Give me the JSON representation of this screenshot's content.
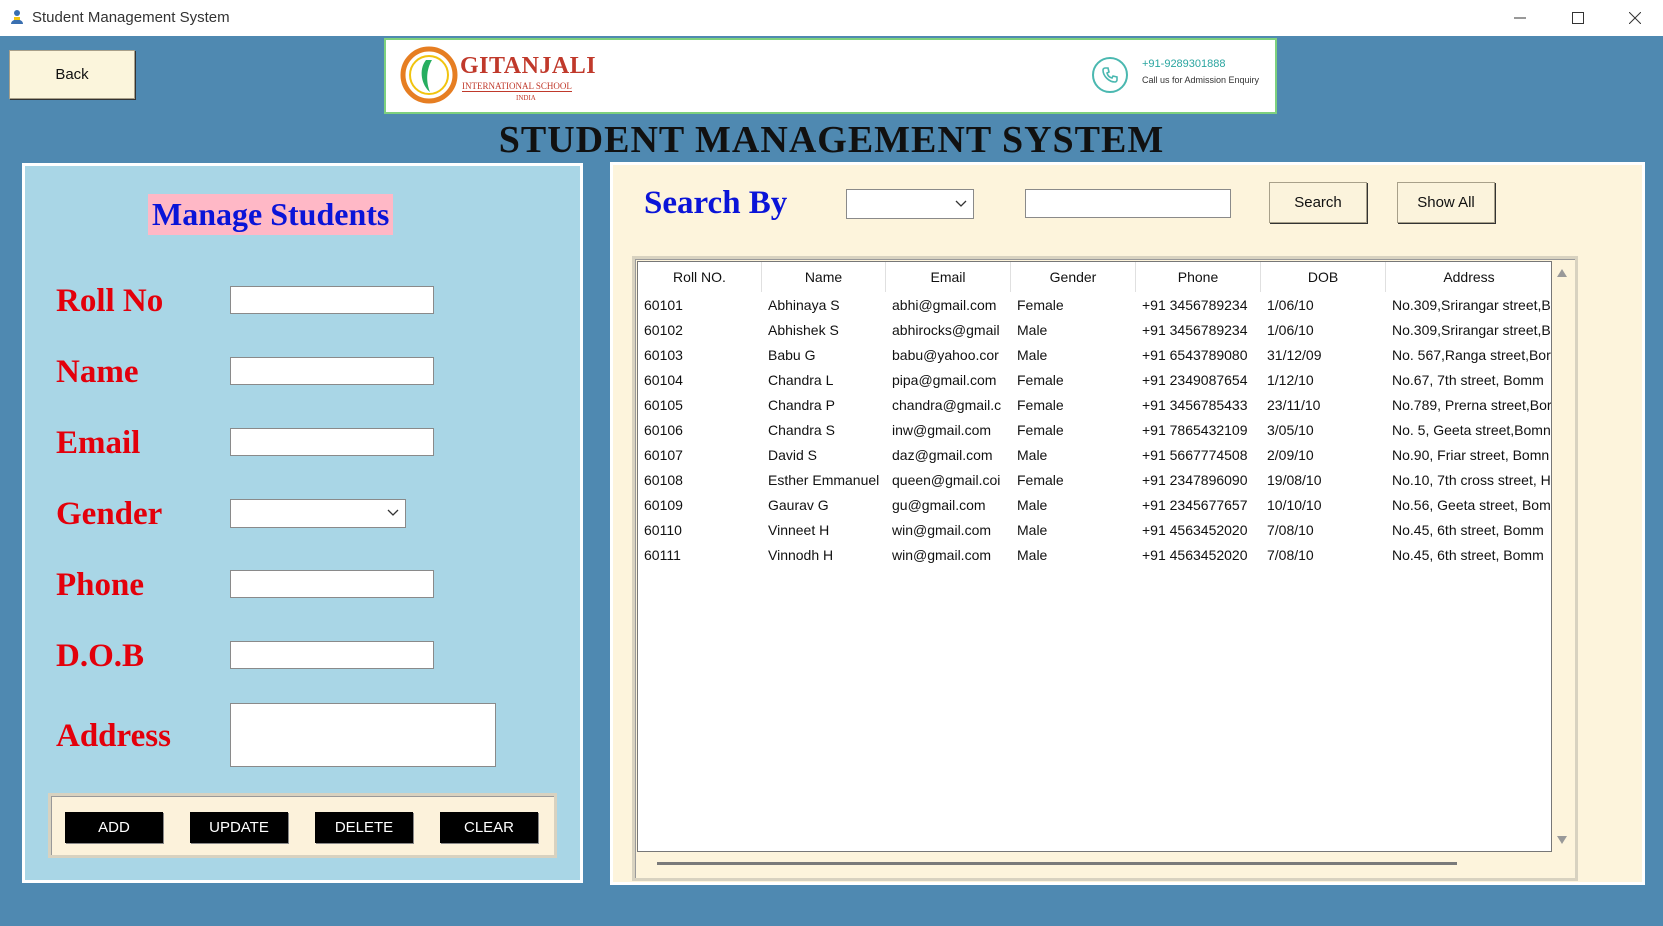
{
  "window": {
    "title": "Student Management System",
    "icons": {
      "app": "student-app-icon",
      "minimize": "minimize-icon",
      "maximize": "maximize-icon",
      "close": "close-icon"
    }
  },
  "header": {
    "back_label": "Back",
    "school_name": "GITANJALI",
    "school_subtitle": "INTERNATIONAL SCHOOL",
    "school_country": "INDIA",
    "phone": "+91-9289301888",
    "phone_note": "Call us for Admission Enquiry",
    "main_title": "STUDENT MANAGEMENT SYSTEM"
  },
  "manage": {
    "title": "Manage Students",
    "fields": {
      "roll_no": {
        "label": "Roll No",
        "value": ""
      },
      "name": {
        "label": "Name",
        "value": ""
      },
      "email": {
        "label": "Email",
        "value": ""
      },
      "gender": {
        "label": "Gender",
        "value": ""
      },
      "phone": {
        "label": "Phone",
        "value": ""
      },
      "dob": {
        "label": "D.O.B",
        "value": ""
      },
      "address": {
        "label": "Address",
        "value": ""
      }
    },
    "buttons": {
      "add": "ADD",
      "update": "UPDATE",
      "delete": "DELETE",
      "clear": "CLEAR"
    }
  },
  "search": {
    "label": "Search By",
    "by_value": "",
    "text_value": "",
    "search_label": "Search",
    "show_all_label": "Show All"
  },
  "table": {
    "columns": [
      "Roll NO.",
      "Name",
      "Email",
      "Gender",
      "Phone",
      "DOB",
      "Address"
    ],
    "rows": [
      [
        "60101",
        "Abhinaya S",
        "abhi@gmail.com",
        "Female",
        "+91 3456789234",
        "1/06/10",
        "No.309,Srirangar street,B"
      ],
      [
        "60102",
        "Abhishek S",
        "abhirocks@gmail",
        "Male",
        "+91 3456789234",
        "1/06/10",
        "No.309,Srirangar street,B"
      ],
      [
        "60103",
        "Babu G",
        "babu@yahoo.cor",
        "Male",
        "+91 6543789080",
        "31/12/09",
        "No. 567,Ranga street,Bor"
      ],
      [
        "60104",
        "Chandra L",
        "pipa@gmail.com",
        "Female",
        "+91 2349087654",
        "1/12/10",
        "No.67, 7th street, Bomm"
      ],
      [
        "60105",
        "Chandra P",
        "chandra@gmail.c",
        "Female",
        "+91 3456785433",
        "23/11/10",
        "No.789, Prerna street,Bor"
      ],
      [
        "60106",
        "Chandra S",
        "inw@gmail.com",
        "Female",
        "+91 7865432109",
        "3/05/10",
        "No. 5, Geeta street,Bomn"
      ],
      [
        "60107",
        "David S",
        "daz@gmail.com",
        "Male",
        "+91 5667774508",
        "2/09/10",
        "No.90, Friar street, Bomn"
      ],
      [
        "60108",
        "Esther Emmanuel",
        "queen@gmail.coi",
        "Female",
        "+91 2347896090",
        "19/08/10",
        "No.10, 7th cross street, H"
      ],
      [
        "60109",
        "Gaurav G",
        "gu@gmail.com",
        "Male",
        "+91 2345677657",
        "10/10/10",
        "No.56, Geeta street, Bom"
      ],
      [
        "60110",
        "Vinneet H",
        "win@gmail.com",
        "Male",
        "+91 4563452020",
        "7/08/10",
        "No.45, 6th street, Bomm"
      ],
      [
        "60111",
        "Vinnodh H",
        "win@gmail.com",
        "Male",
        "+91 4563452020",
        "7/08/10",
        "No.45, 6th street, Bomm"
      ]
    ]
  },
  "colors": {
    "background": "#4f89b1",
    "left_panel": "#a9d6e6",
    "right_panel": "#fdf4dc",
    "label_red": "#e3000b",
    "heading_blue": "#0a14d8",
    "manage_highlight": "#ffb8c6"
  }
}
